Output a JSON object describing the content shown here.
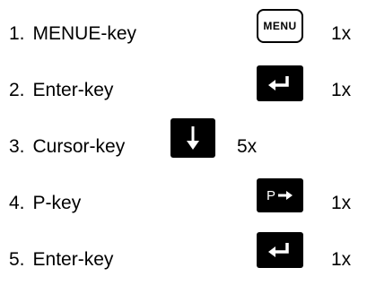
{
  "steps": [
    {
      "number": "1.",
      "label": "MENUE-key",
      "count": "1x",
      "key": {
        "type": "outline",
        "icon": "menu-key-icon",
        "text": "MENU"
      }
    },
    {
      "number": "2.",
      "label": "Enter-key",
      "count": "1x",
      "key": {
        "type": "solid",
        "icon": "enter-key-icon"
      }
    },
    {
      "number": "3.",
      "label": "Cursor-key",
      "count": "5x",
      "key": {
        "type": "solid",
        "icon": "cursor-down-key-icon"
      }
    },
    {
      "number": "4.",
      "label": "P-key",
      "count": "1x",
      "key": {
        "type": "solid",
        "icon": "p-key-icon",
        "text": "P"
      }
    },
    {
      "number": "5.",
      "label": "Enter-key",
      "count": "1x",
      "key": {
        "type": "solid",
        "icon": "enter-key-icon"
      }
    }
  ]
}
